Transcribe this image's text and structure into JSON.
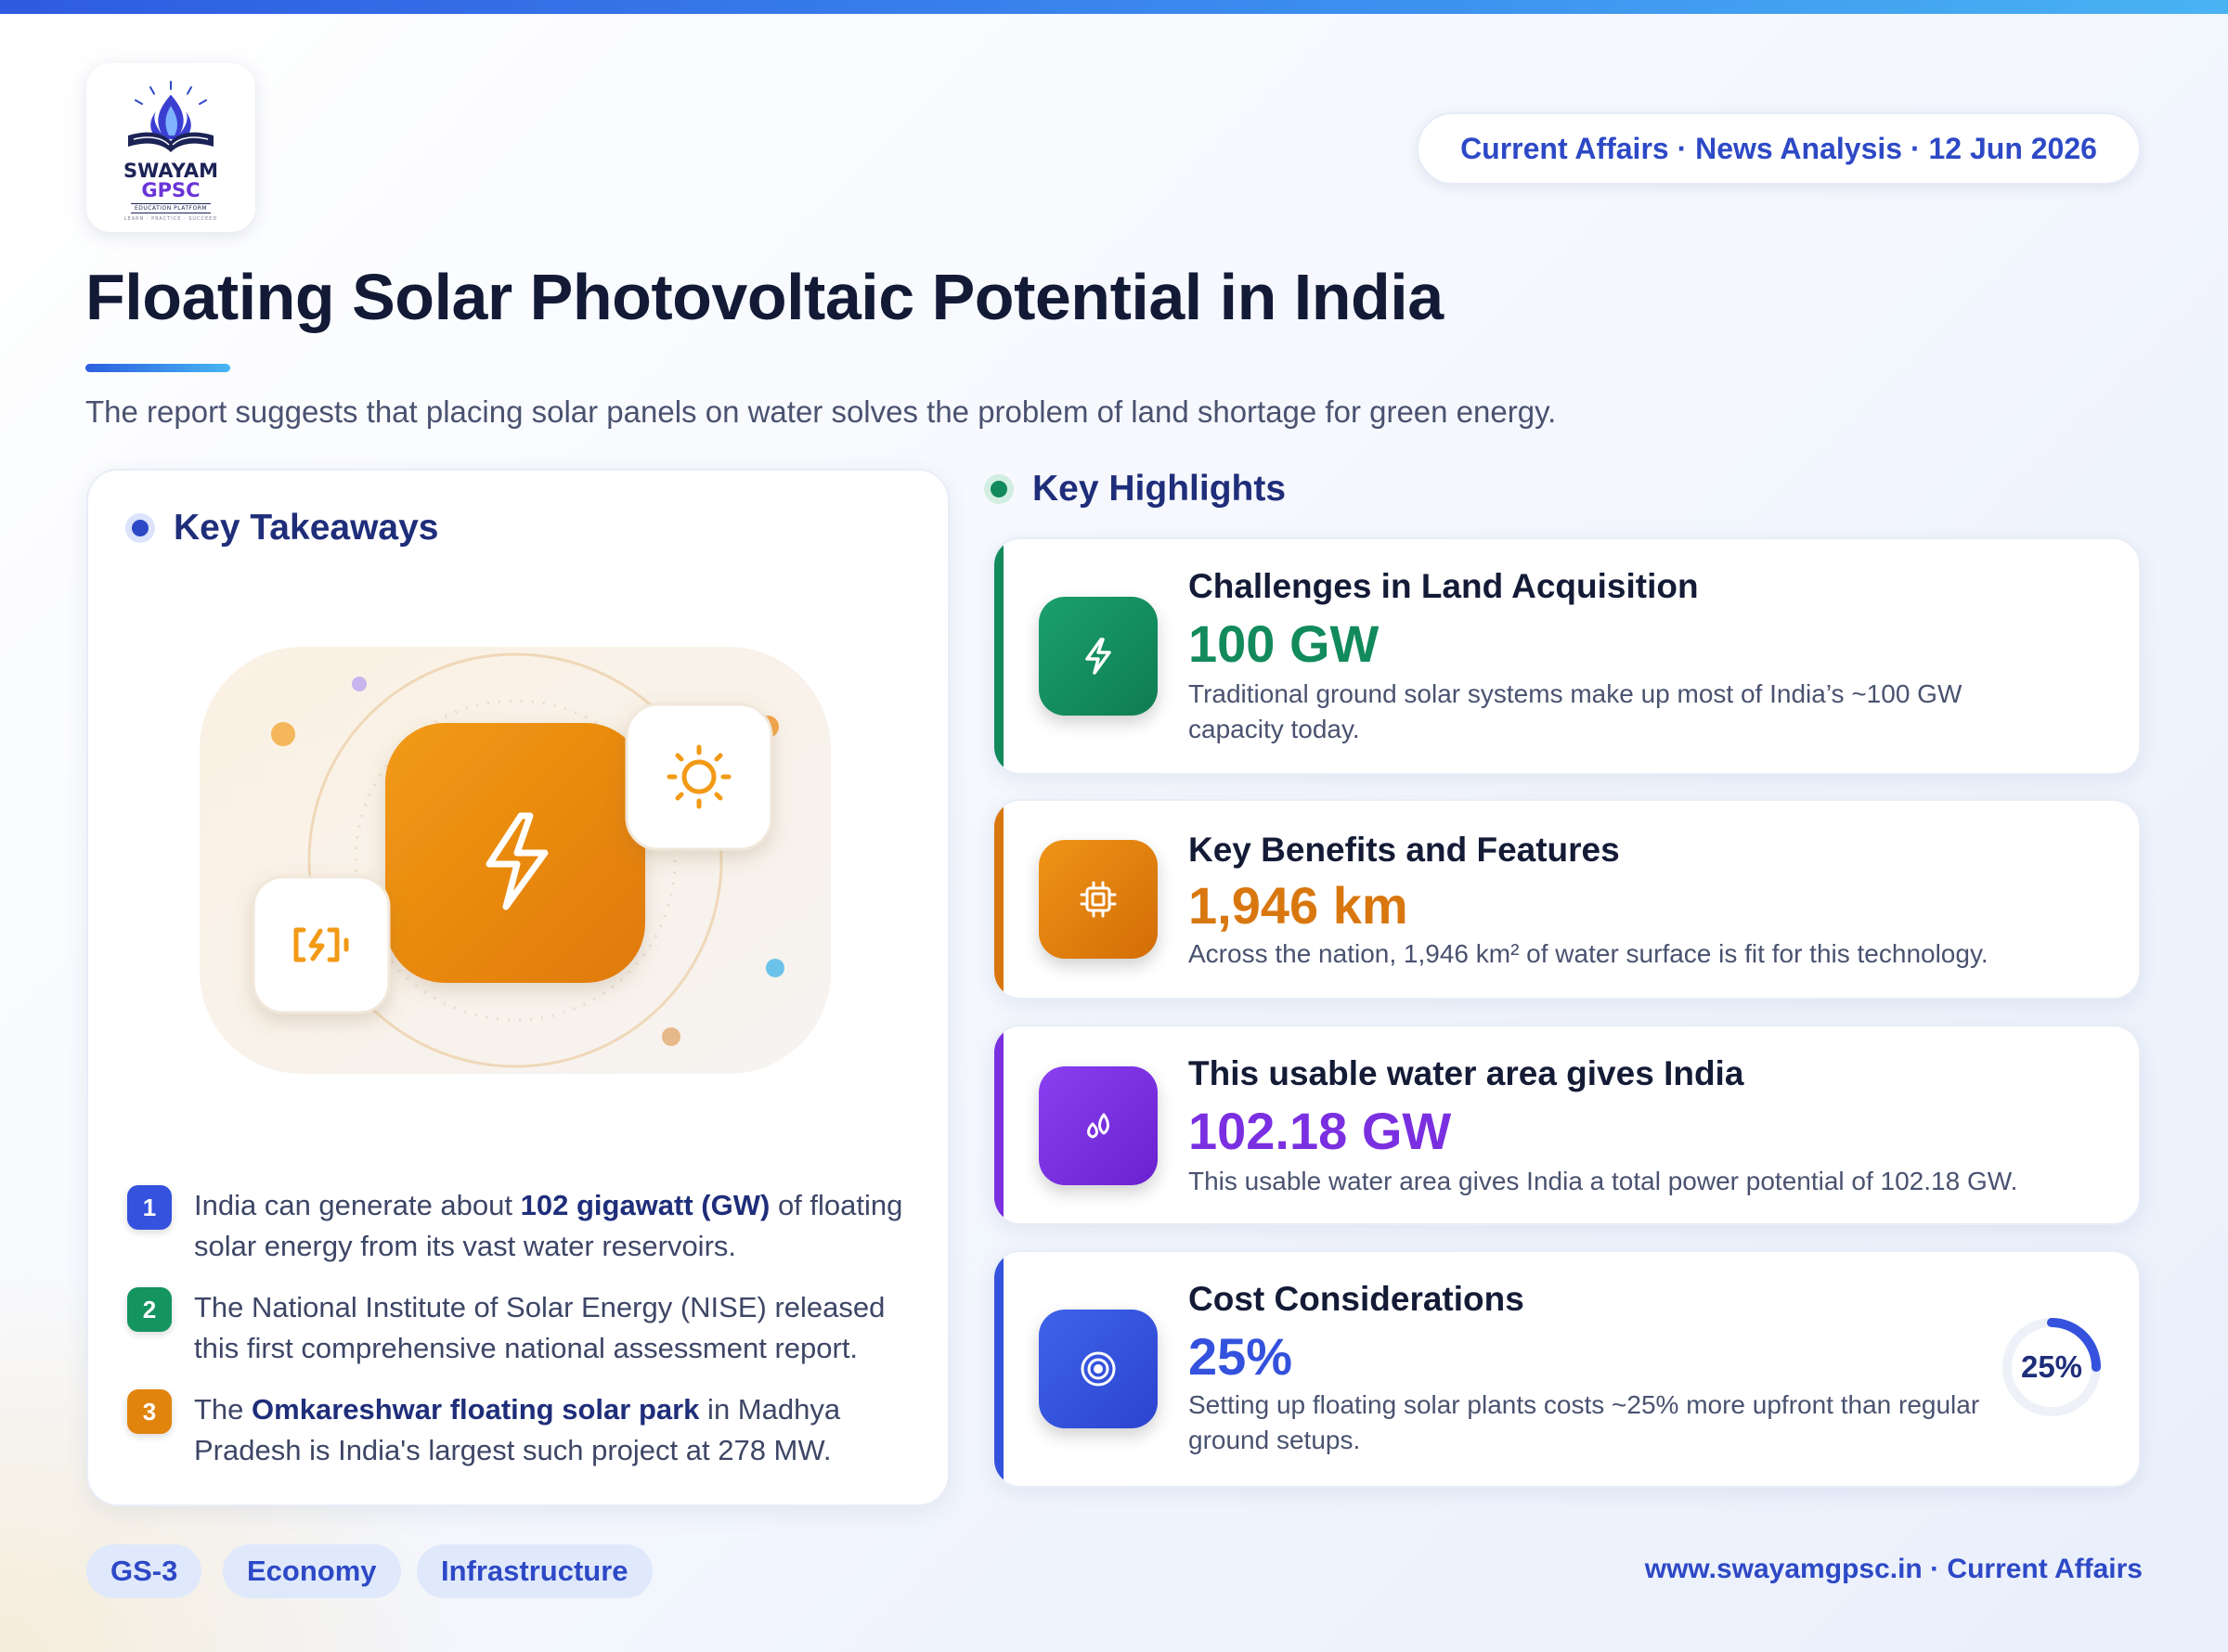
{
  "brand": {
    "name": "SWAYAM",
    "sub": "GPSC",
    "tagline": "EDUCATION PLATFORM",
    "motto": "LEARN · PRACTICE · SUCCEED"
  },
  "meta_pill": "Current Affairs · News Analysis · 12 Jun 2026",
  "title": "Floating Solar Photovoltaic Potential in India",
  "subtitle": "The report suggests that placing solar panels on water solves the problem of land shortage for green energy.",
  "takeaways": {
    "heading": "Key Takeaways",
    "items": [
      {
        "number": "1",
        "pre": "India can generate about ",
        "bold": "102 gigawatt (GW)",
        "post": " of floating solar energy from its vast water reservoirs."
      },
      {
        "number": "2",
        "pre": "The National Institute of Solar Energy (NISE) released this first comprehensive national assessment report.",
        "bold": "",
        "post": ""
      },
      {
        "number": "3",
        "pre": "The ",
        "bold": "Omkareshwar floating solar park",
        "post": " in Madhya Pradesh is India's largest such project at 278 MW."
      }
    ]
  },
  "highlights": {
    "heading": "Key Highlights",
    "cards": [
      {
        "title": "Challenges in Land Acquisition",
        "value": "100 GW",
        "text": "Traditional ground solar systems make up most of India’s ~100 GW capacity today.",
        "icon": "lightning-icon",
        "color": "#128a5c"
      },
      {
        "title": "Key Benefits and Features",
        "value": "1,946 km",
        "text": "Across the nation, 1,946 km² of water surface is fit for this technology.",
        "icon": "chip-icon",
        "color": "#d9770f"
      },
      {
        "title": "This usable water area gives India",
        "value": "102.18 GW",
        "text": "This usable water area gives India a total power potential of 102.18 GW.",
        "icon": "droplets-icon",
        "color": "#7a2fe0"
      },
      {
        "title": "Cost Considerations",
        "value": "25%",
        "text": "Setting up floating solar plants costs ~25% more upfront than regular ground setups.",
        "icon": "target-icon",
        "color": "#3452dd",
        "gauge_label": "25%",
        "gauge_fraction": 0.25
      }
    ]
  },
  "tags": [
    "GS-3",
    "Economy",
    "Infrastructure"
  ],
  "footer": "www.swayamgpsc.in · Current Affairs"
}
